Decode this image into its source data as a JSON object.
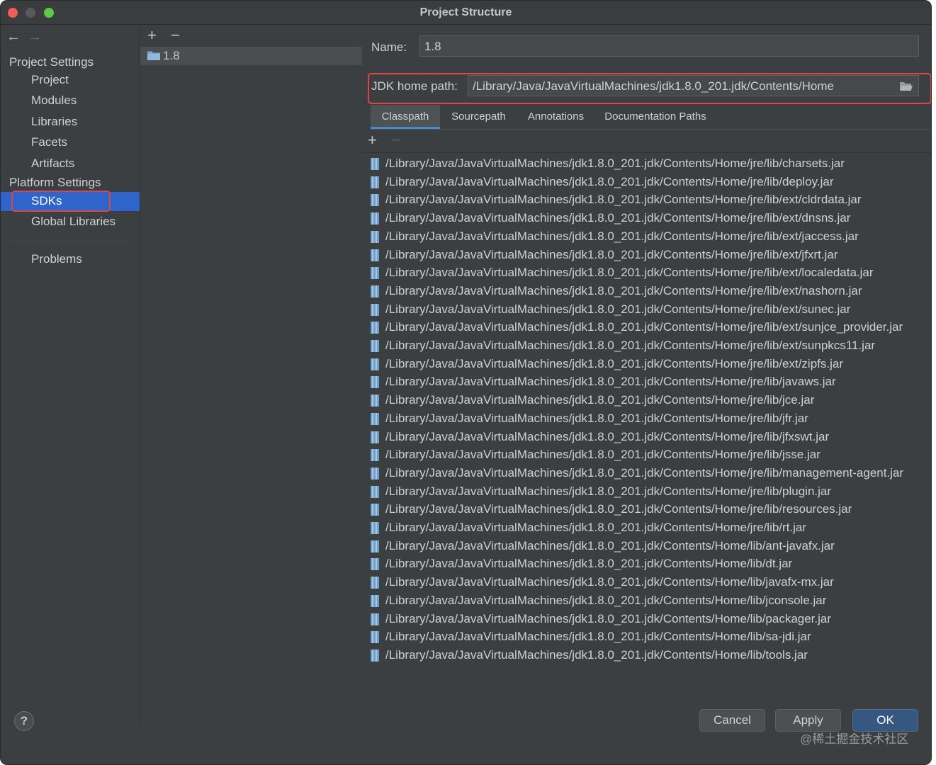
{
  "window": {
    "title": "Project Structure"
  },
  "nav": {
    "back_glyph": "←",
    "forward_glyph": "→",
    "project_settings_header": "Project Settings",
    "project_items": [
      "Project",
      "Modules",
      "Libraries",
      "Facets",
      "Artifacts"
    ],
    "platform_settings_header": "Platform Settings",
    "platform_items": [
      "SDKs",
      "Global Libraries"
    ],
    "selected_item": "SDKs",
    "problems": "Problems"
  },
  "sdk_list": {
    "add_glyph": "+",
    "remove_glyph": "−",
    "items": [
      "1.8"
    ]
  },
  "details": {
    "name_label": "Name:",
    "name_value": "1.8",
    "jdk_home_label": "JDK home path:",
    "jdk_home_value": "/Library/Java/JavaVirtualMachines/jdk1.8.0_201.jdk/Contents/Home",
    "tabs": [
      "Classpath",
      "Sourcepath",
      "Annotations",
      "Documentation Paths"
    ],
    "active_tab": "Classpath",
    "add_glyph": "+",
    "remove_glyph": "−",
    "classpath": [
      "/Library/Java/JavaVirtualMachines/jdk1.8.0_201.jdk/Contents/Home/jre/lib/charsets.jar",
      "/Library/Java/JavaVirtualMachines/jdk1.8.0_201.jdk/Contents/Home/jre/lib/deploy.jar",
      "/Library/Java/JavaVirtualMachines/jdk1.8.0_201.jdk/Contents/Home/jre/lib/ext/cldrdata.jar",
      "/Library/Java/JavaVirtualMachines/jdk1.8.0_201.jdk/Contents/Home/jre/lib/ext/dnsns.jar",
      "/Library/Java/JavaVirtualMachines/jdk1.8.0_201.jdk/Contents/Home/jre/lib/ext/jaccess.jar",
      "/Library/Java/JavaVirtualMachines/jdk1.8.0_201.jdk/Contents/Home/jre/lib/ext/jfxrt.jar",
      "/Library/Java/JavaVirtualMachines/jdk1.8.0_201.jdk/Contents/Home/jre/lib/ext/localedata.jar",
      "/Library/Java/JavaVirtualMachines/jdk1.8.0_201.jdk/Contents/Home/jre/lib/ext/nashorn.jar",
      "/Library/Java/JavaVirtualMachines/jdk1.8.0_201.jdk/Contents/Home/jre/lib/ext/sunec.jar",
      "/Library/Java/JavaVirtualMachines/jdk1.8.0_201.jdk/Contents/Home/jre/lib/ext/sunjce_provider.jar",
      "/Library/Java/JavaVirtualMachines/jdk1.8.0_201.jdk/Contents/Home/jre/lib/ext/sunpkcs11.jar",
      "/Library/Java/JavaVirtualMachines/jdk1.8.0_201.jdk/Contents/Home/jre/lib/ext/zipfs.jar",
      "/Library/Java/JavaVirtualMachines/jdk1.8.0_201.jdk/Contents/Home/jre/lib/javaws.jar",
      "/Library/Java/JavaVirtualMachines/jdk1.8.0_201.jdk/Contents/Home/jre/lib/jce.jar",
      "/Library/Java/JavaVirtualMachines/jdk1.8.0_201.jdk/Contents/Home/jre/lib/jfr.jar",
      "/Library/Java/JavaVirtualMachines/jdk1.8.0_201.jdk/Contents/Home/jre/lib/jfxswt.jar",
      "/Library/Java/JavaVirtualMachines/jdk1.8.0_201.jdk/Contents/Home/jre/lib/jsse.jar",
      "/Library/Java/JavaVirtualMachines/jdk1.8.0_201.jdk/Contents/Home/jre/lib/management-agent.jar",
      "/Library/Java/JavaVirtualMachines/jdk1.8.0_201.jdk/Contents/Home/jre/lib/plugin.jar",
      "/Library/Java/JavaVirtualMachines/jdk1.8.0_201.jdk/Contents/Home/jre/lib/resources.jar",
      "/Library/Java/JavaVirtualMachines/jdk1.8.0_201.jdk/Contents/Home/jre/lib/rt.jar",
      "/Library/Java/JavaVirtualMachines/jdk1.8.0_201.jdk/Contents/Home/lib/ant-javafx.jar",
      "/Library/Java/JavaVirtualMachines/jdk1.8.0_201.jdk/Contents/Home/lib/dt.jar",
      "/Library/Java/JavaVirtualMachines/jdk1.8.0_201.jdk/Contents/Home/lib/javafx-mx.jar",
      "/Library/Java/JavaVirtualMachines/jdk1.8.0_201.jdk/Contents/Home/lib/jconsole.jar",
      "/Library/Java/JavaVirtualMachines/jdk1.8.0_201.jdk/Contents/Home/lib/packager.jar",
      "/Library/Java/JavaVirtualMachines/jdk1.8.0_201.jdk/Contents/Home/lib/sa-jdi.jar",
      "/Library/Java/JavaVirtualMachines/jdk1.8.0_201.jdk/Contents/Home/lib/tools.jar"
    ]
  },
  "footer": {
    "help_label": "?",
    "cancel_label": "Cancel",
    "apply_label": "Apply",
    "ok_label": "OK",
    "watermark": "@稀土掘金技术社区"
  },
  "colors": {
    "selection_blue": "#2f65ca",
    "highlight_red": "#e0463f",
    "ok_button": "#365880"
  }
}
